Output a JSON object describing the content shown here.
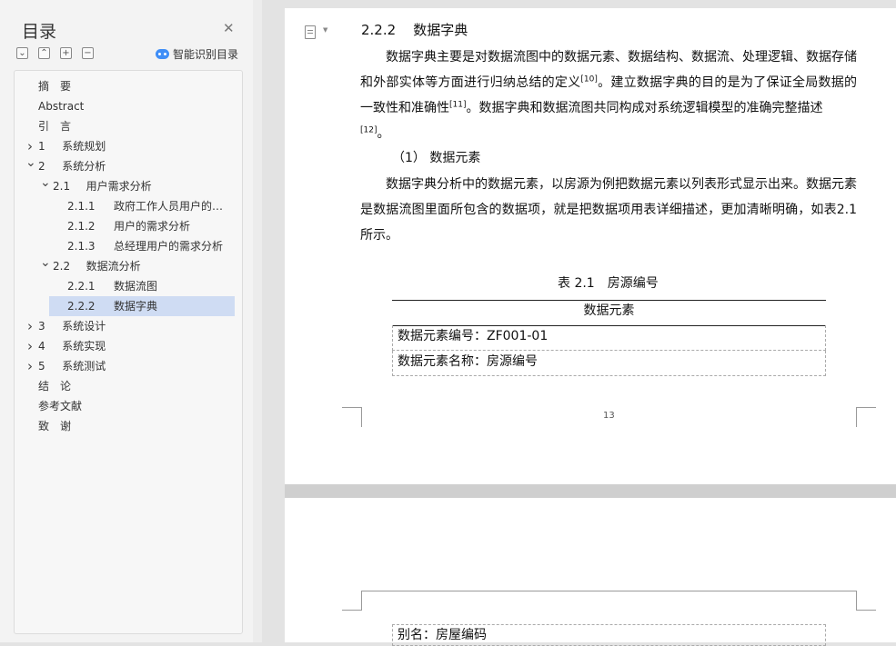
{
  "toc": {
    "title": "目录",
    "close_icon": "close-icon",
    "smart_label": "智能识别目录",
    "tools": [
      "collapse-all-icon",
      "expand-icon",
      "add-heading-icon",
      "remove-heading-icon"
    ],
    "items": [
      {
        "num": "摘　要",
        "label": "",
        "level": 0,
        "chevron": "",
        "active": false
      },
      {
        "num": "Abstract",
        "label": "",
        "level": 0,
        "chevron": "",
        "active": false
      },
      {
        "num": "引　言",
        "label": "",
        "level": 0,
        "chevron": "",
        "active": false
      },
      {
        "num": "1",
        "label": "系统规划",
        "level": 0,
        "chevron": "right",
        "active": false
      },
      {
        "num": "2",
        "label": "系统分析",
        "level": 0,
        "chevron": "down",
        "active": false
      },
      {
        "num": "2.1",
        "label": "用户需求分析",
        "level": 1,
        "chevron": "down",
        "active": false
      },
      {
        "num": "2.1.1",
        "label": "政府工作人员用户的需求分析",
        "level": 2,
        "chevron": "",
        "active": false
      },
      {
        "num": "2.1.2",
        "label": "用户的需求分析",
        "level": 2,
        "chevron": "",
        "active": false
      },
      {
        "num": "2.1.3",
        "label": "总经理用户的需求分析",
        "level": 2,
        "chevron": "",
        "active": false
      },
      {
        "num": "2.2",
        "label": "数据流分析",
        "level": 1,
        "chevron": "down",
        "active": false
      },
      {
        "num": "2.2.1",
        "label": "数据流图",
        "level": 2,
        "chevron": "",
        "active": false
      },
      {
        "num": "2.2.2",
        "label": "数据字典",
        "level": 2,
        "chevron": "",
        "active": true
      },
      {
        "num": "3",
        "label": "系统设计",
        "level": 0,
        "chevron": "right",
        "active": false
      },
      {
        "num": "4",
        "label": "系统实现",
        "level": 0,
        "chevron": "right",
        "active": false
      },
      {
        "num": "5",
        "label": "系统测试",
        "level": 0,
        "chevron": "right",
        "active": false
      },
      {
        "num": "结　论",
        "label": "",
        "level": 0,
        "chevron": "",
        "active": false
      },
      {
        "num": "参考文献",
        "label": "",
        "level": 0,
        "chevron": "",
        "active": false
      },
      {
        "num": "致　谢",
        "label": "",
        "level": 0,
        "chevron": "",
        "active": false
      }
    ]
  },
  "document": {
    "heading_num": "2.2.2",
    "heading_text": "数据字典",
    "p1_a": "数据字典主要是对数据流图中的数据元素、数据结构、数据流、处理逻辑、数据存储和外部实体等方面进行归纳总结的定义",
    "p1_ref1": "[10]",
    "p1_b": "。建立数据字典的目的是为了保证全局数据的一致性和准确性",
    "p1_ref2": "[11]",
    "p1_c": "。数据字典和数据流图共同构成对系统逻辑模型的准确完整描述",
    "p1_ref3": "[12]",
    "p1_d": "。",
    "sub_heading": "（1）  数据元素",
    "p2": "数据字典分析中的数据元素，以房源为例把数据元素以列表形式显示出来。数据元素是数据流图里面所包含的数据项，就是把数据项用表详细描述，更加清晰明确，如表2.1所示。",
    "table_caption": "表 2.1　房源编号",
    "table_header": "数据元素",
    "table_rows": [
      "数据元素编号：ZF001-01",
      "数据元素名称：房源编号"
    ],
    "page_number": "13",
    "page2_row": "别名：房屋编码"
  }
}
